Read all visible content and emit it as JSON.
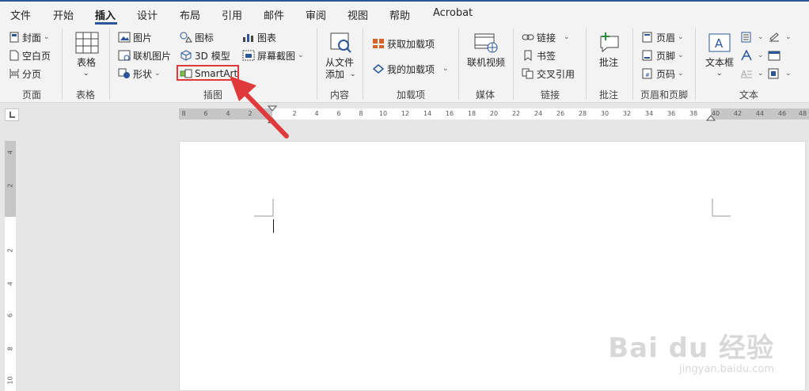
{
  "tabs": [
    "文件",
    "开始",
    "插入",
    "设计",
    "布局",
    "引用",
    "邮件",
    "审阅",
    "视图",
    "帮助",
    "Acrobat"
  ],
  "active_tab": "插入",
  "groups": {
    "page": {
      "label": "页面",
      "items": [
        "封面",
        "空白页",
        "分页"
      ]
    },
    "table": {
      "label": "表格",
      "button": "表格"
    },
    "illustrations": {
      "label": "插图",
      "col1": [
        "图片",
        "联机图片",
        "形状"
      ],
      "col2": [
        "图标",
        "3D 模型",
        "SmartArt"
      ],
      "col3": [
        "图表",
        "屏幕截图"
      ]
    },
    "content": {
      "label": "内容",
      "button_line1": "从文件",
      "button_line2": "添加"
    },
    "addins": {
      "label": "加载项",
      "items": [
        "获取加载项",
        "我的加载项"
      ]
    },
    "media": {
      "label": "媒体",
      "button": "联机视频"
    },
    "links": {
      "label": "链接",
      "items": [
        "链接",
        "书签",
        "交叉引用"
      ]
    },
    "comments": {
      "label": "批注",
      "button": "批注"
    },
    "header_footer": {
      "label": "页眉和页脚",
      "items": [
        "页眉",
        "页脚",
        "页码"
      ]
    },
    "text": {
      "label": "文本",
      "button": "文本框"
    }
  },
  "ruler": {
    "horizontal_ticks": [
      "8",
      "6",
      "4",
      "2",
      "2",
      "4",
      "6",
      "8",
      "10",
      "12",
      "14",
      "16",
      "18",
      "20",
      "22",
      "24",
      "26",
      "28",
      "30",
      "32",
      "34",
      "36",
      "38",
      "40",
      "42",
      "44",
      "46",
      "48"
    ],
    "vertical_ticks": [
      "4",
      "2",
      "2",
      "4",
      "6",
      "8",
      "10"
    ]
  },
  "watermark": {
    "brand": "Bai du 经验",
    "url": "jingyan.baidu.com"
  },
  "colors": {
    "accent": "#2b579a",
    "highlight": "#e0393b"
  }
}
